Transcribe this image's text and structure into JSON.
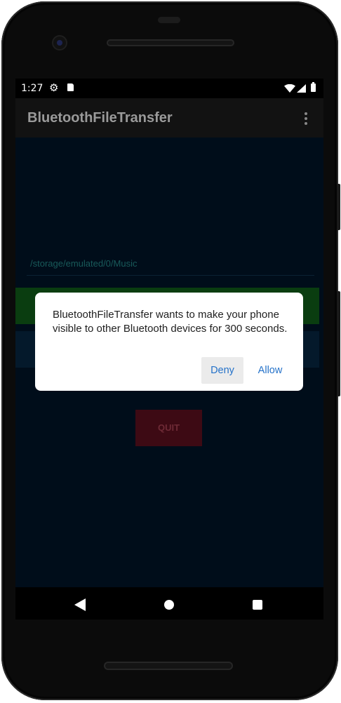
{
  "status_bar": {
    "time": "1:27",
    "icons": [
      "gear-icon",
      "sd-card-icon",
      "wifi-icon",
      "signal-icon",
      "battery-icon"
    ]
  },
  "app_bar": {
    "title": "BluetoothFileTransfer",
    "menu_icon": "overflow-menu-icon"
  },
  "main": {
    "path": "/storage/emulated/0/Music",
    "quit_label": "QUIT"
  },
  "dialog": {
    "message": "BluetoothFileTransfer wants to make your phone visible to other Bluetooth devices for 300 seconds.",
    "deny_label": "Deny",
    "allow_label": "Allow"
  },
  "nav_bar": {
    "icons": [
      "back-icon",
      "home-icon",
      "recents-icon"
    ]
  },
  "colors": {
    "accent": "#2572c9",
    "content_bg": "#000d1a",
    "green_button": "#0a3d10",
    "quit_button": "#3d0a14"
  }
}
